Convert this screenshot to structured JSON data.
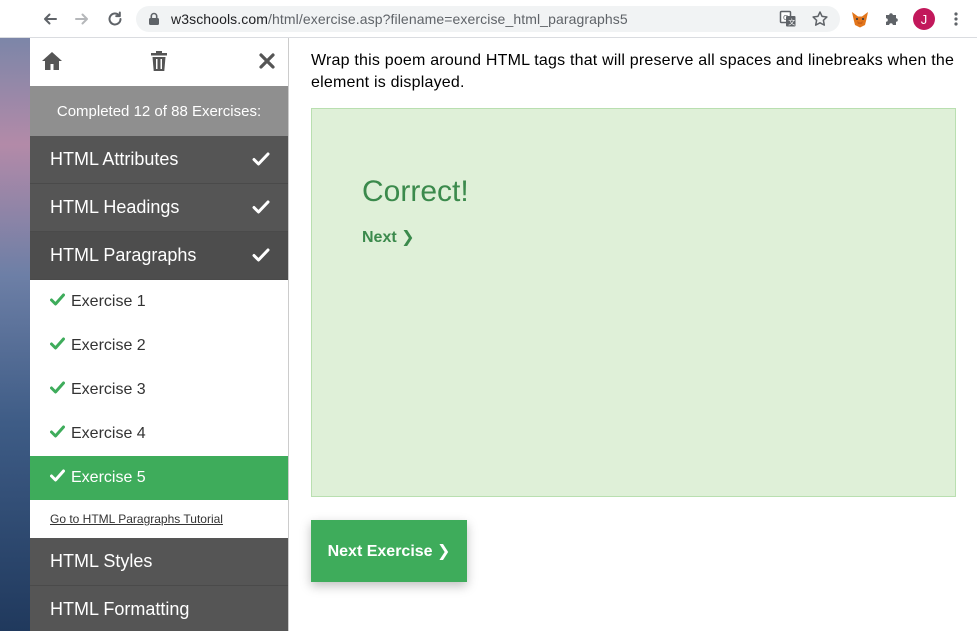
{
  "browser": {
    "url_host": "w3schools.com",
    "url_path": "/html/exercise.asp?filename=exercise_html_paragraphs5",
    "avatar_letter": "J",
    "avatar_color": "#c2185b"
  },
  "sidebar": {
    "completed_text": "Completed 12 of 88 Exercises:",
    "categories_top": [
      {
        "label": "HTML Attributes"
      },
      {
        "label": "HTML Headings"
      },
      {
        "label": "HTML Paragraphs"
      }
    ],
    "exercises": [
      {
        "label": "Exercise 1"
      },
      {
        "label": "Exercise 2"
      },
      {
        "label": "Exercise 3"
      },
      {
        "label": "Exercise 4"
      },
      {
        "label": "Exercise 5"
      }
    ],
    "tutorial_link": "Go to HTML Paragraphs Tutorial",
    "categories_bottom": [
      {
        "label": "HTML Styles"
      },
      {
        "label": "HTML Formatting"
      }
    ]
  },
  "main": {
    "instruction": "Wrap this poem around HTML tags that will preserve all spaces and linebreaks when the element is displayed.",
    "result_title": "Correct!",
    "next_link": "Next ❯",
    "next_exercise_button": "Next Exercise ❯"
  },
  "colors": {
    "accent_green": "#3eac5b",
    "result_bg": "#dff0d8",
    "sidebar_dark": "#555555"
  }
}
